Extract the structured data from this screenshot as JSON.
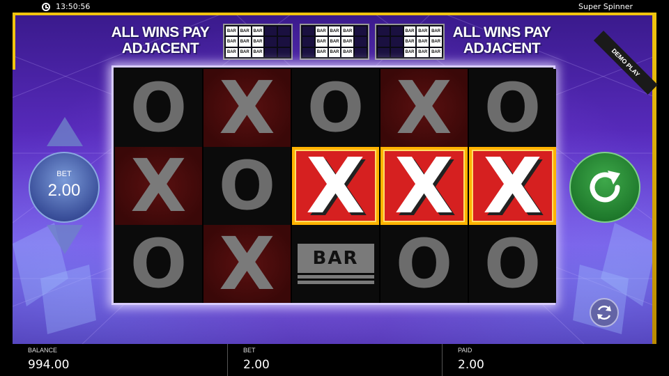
{
  "status_bar": {
    "time": "13:50:56",
    "game_title": "Super Spinner"
  },
  "banner": {
    "left_text_line1": "ALL WINS PAY",
    "left_text_line2": "ADJACENT",
    "right_text_line1": "ALL WINS PAY",
    "right_text_line2": "ADJACENT",
    "mini_reel_label": "BAR",
    "demo_label": "DEMO PLAY"
  },
  "reels": [
    [
      "O",
      "X",
      "O",
      "X",
      "O"
    ],
    [
      "X",
      "O",
      "X",
      "X",
      "X"
    ],
    [
      "O",
      "X",
      "BAR",
      "O",
      "O"
    ]
  ],
  "winning_cells": [
    [
      1,
      2
    ],
    [
      1,
      3
    ],
    [
      1,
      4
    ]
  ],
  "bet_control": {
    "caption": "BET",
    "value": "2.00"
  },
  "bottom": {
    "balance_caption": "BALANCE",
    "balance_value": "994.00",
    "bet_caption": "BET",
    "bet_value": "2.00",
    "paid_caption": "PAID",
    "paid_value": "2.00"
  },
  "colors": {
    "frame": "#f1c40f",
    "win_cell": "#d62020",
    "spin_button": "#2e8b3a",
    "bet_button": "#3a4f9a"
  },
  "icons": {
    "clock": "clock-icon",
    "spin": "spin-arrow-icon",
    "autoplay": "autoplay-icon",
    "bet_up": "triangle-up-icon",
    "bet_down": "triangle-down-icon"
  }
}
